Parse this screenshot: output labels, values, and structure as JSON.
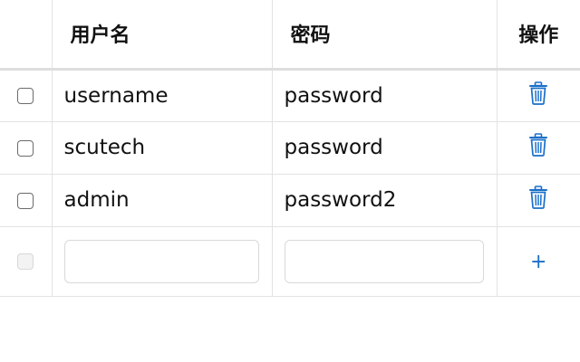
{
  "table": {
    "headers": {
      "username": "用户名",
      "password": "密码",
      "action": "操作"
    },
    "rows": [
      {
        "username": "username",
        "password": "password",
        "checked": false
      },
      {
        "username": "scutech",
        "password": "password",
        "checked": false
      },
      {
        "username": "admin",
        "password": "password2",
        "checked": false
      }
    ],
    "new_row": {
      "username_value": "",
      "password_value": "",
      "add_symbol": "+"
    }
  },
  "colors": {
    "accent": "#1a6fc9",
    "border": "#e3e3e3",
    "header_border": "#dedede"
  },
  "icons": {
    "delete": "trash-icon",
    "add": "plus-icon"
  }
}
